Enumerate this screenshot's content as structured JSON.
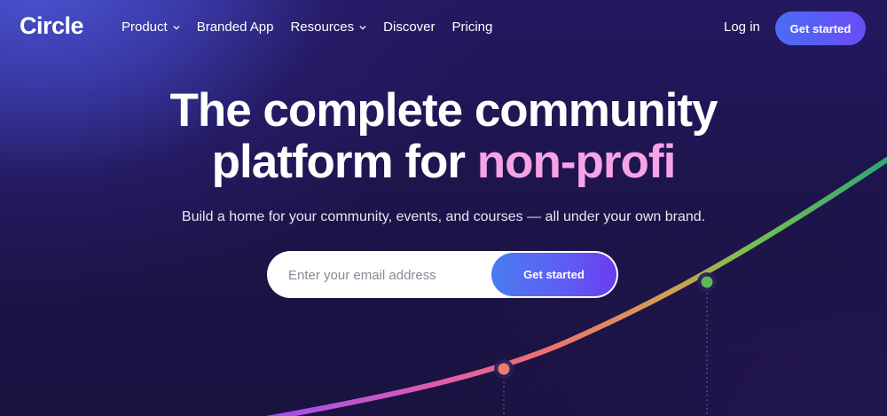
{
  "nav": {
    "logo": "Circle",
    "items": [
      {
        "label": "Product",
        "dropdown": true
      },
      {
        "label": "Branded App",
        "dropdown": false
      },
      {
        "label": "Resources",
        "dropdown": true
      },
      {
        "label": "Discover",
        "dropdown": false
      },
      {
        "label": "Pricing",
        "dropdown": false
      }
    ],
    "login": "Log in",
    "cta": "Get started"
  },
  "hero": {
    "title_line1": "The complete community",
    "title_line2_prefix": "platform for ",
    "title_line2_accent": "non-profi",
    "subtitle": "Build a home for your community, events, and courses — all under your own brand."
  },
  "signup": {
    "email_placeholder": "Enter your email address",
    "email_value": "",
    "cta": "Get started"
  },
  "colors": {
    "accent_pink": "#f7a3e6",
    "button_blue": "#4a6cf7",
    "background": "#1a1240"
  }
}
